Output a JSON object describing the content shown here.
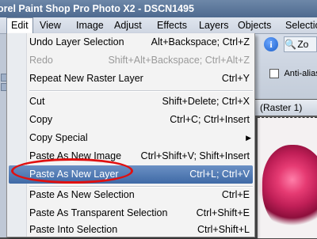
{
  "window": {
    "title": "orel Paint Shop Pro Photo X2 - DSCN1495"
  },
  "menubar": {
    "items": [
      {
        "label": "Edit"
      },
      {
        "label": "View"
      },
      {
        "label": "Image"
      },
      {
        "label": "Adjust"
      },
      {
        "label": "Effects"
      },
      {
        "label": "Layers"
      },
      {
        "label": "Objects"
      },
      {
        "label": "Selectio"
      }
    ]
  },
  "toolbar": {
    "info_icon": "info-icon",
    "info_glyph": "i",
    "zoom_label": "Zo",
    "zoom_glyph": "🔍",
    "anti_alias_label": "Anti-alias"
  },
  "document": {
    "tab_label": "(Raster 1)"
  },
  "edit_menu": {
    "items": [
      {
        "label": "Undo Layer Selection",
        "shortcut": "Alt+Backspace; Ctrl+Z",
        "disabled": false
      },
      {
        "label": "Redo",
        "shortcut": "Shift+Alt+Backspace; Ctrl+Alt+Z",
        "disabled": true
      },
      {
        "label": "Repeat  New Raster Layer",
        "shortcut": "Ctrl+Y",
        "disabled": false
      },
      {
        "label": "Cut",
        "shortcut": "Shift+Delete; Ctrl+X",
        "disabled": false
      },
      {
        "label": "Copy",
        "shortcut": "Ctrl+C; Ctrl+Insert",
        "disabled": false
      },
      {
        "label": "Copy Special",
        "shortcut": "",
        "submenu": true,
        "disabled": false
      },
      {
        "label": "Paste As New Image",
        "shortcut": "Ctrl+Shift+V; Shift+Insert",
        "disabled": false
      },
      {
        "label": "Paste As New Layer",
        "shortcut": "Ctrl+L; Ctrl+V",
        "highlighted": true,
        "disabled": false
      },
      {
        "label": "Paste As New Selection",
        "shortcut": "Ctrl+E",
        "disabled": false
      },
      {
        "label": "Paste As Transparent Selection",
        "shortcut": "Ctrl+Shift+E",
        "disabled": false
      },
      {
        "label": "Paste Into Selection",
        "shortcut": "Ctrl+Shift+L",
        "disabled": false
      }
    ],
    "submenu_glyph": "▶"
  },
  "colors": {
    "highlight": "#3f6aa6",
    "annotation": "#e01010",
    "title_bar": "#4e6a8f"
  }
}
